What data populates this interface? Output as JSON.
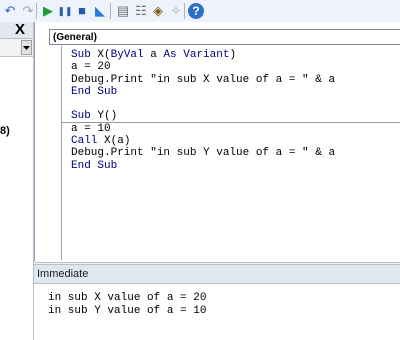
{
  "toolbar": {
    "buttons": [
      {
        "name": "undo-icon",
        "glyph": "↶",
        "color": "#2f67b6"
      },
      {
        "name": "redo-icon",
        "glyph": "↷",
        "color": "#9aa5b5"
      },
      {
        "name": "run-icon",
        "glyph": "▶",
        "color": "#1d9b2f"
      },
      {
        "name": "pause-icon",
        "glyph": "❚❚",
        "color": "#1f5fa8"
      },
      {
        "name": "stop-icon",
        "glyph": "■",
        "color": "#1f5fa8"
      },
      {
        "name": "design-mode-icon",
        "glyph": "◣",
        "color": "#2b7bd6"
      },
      {
        "name": "project-explorer-icon",
        "glyph": "▤",
        "color": "#6a6f7a"
      },
      {
        "name": "properties-icon",
        "glyph": "☷",
        "color": "#6a6f7a"
      },
      {
        "name": "object-browser-icon",
        "glyph": "◈",
        "color": "#7a5b12"
      },
      {
        "name": "toolbox-icon",
        "glyph": "✧",
        "color": "#a9adb5"
      },
      {
        "name": "help-icon",
        "glyph": "?",
        "color": "#ffffff"
      }
    ]
  },
  "left_panel": {
    "close_label": "X",
    "partial_text": "8)"
  },
  "code_window": {
    "procedure_dropdown": "(General)",
    "lines": [
      [
        {
          "t": "Sub ",
          "k": true
        },
        {
          "t": "X(",
          "k": false
        },
        {
          "t": "ByVal",
          "k": true
        },
        {
          "t": " a ",
          "k": false
        },
        {
          "t": "As Variant",
          "k": true
        },
        {
          "t": ")",
          "k": false
        }
      ],
      [
        {
          "t": "a = 20",
          "k": false
        }
      ],
      [
        {
          "t": "Debug.Print \"in sub X value of a = \" & a",
          "k": false
        }
      ],
      [
        {
          "t": "End Sub",
          "k": true
        }
      ],
      [],
      [
        {
          "t": "Sub ",
          "k": true
        },
        {
          "t": "Y()",
          "k": false
        }
      ],
      [
        {
          "t": "a = 10",
          "k": false
        }
      ],
      [
        {
          "t": "Call ",
          "k": true
        },
        {
          "t": "X(a)",
          "k": false
        }
      ],
      [
        {
          "t": "Debug.Print \"in sub Y value of a = \" & a",
          "k": false
        }
      ],
      [
        {
          "t": "End Sub",
          "k": true
        }
      ]
    ]
  },
  "immediate": {
    "title": "Immediate",
    "output": [
      "in sub X value of a = 20",
      "in sub Y value of a = 10"
    ]
  },
  "colors": {
    "keyword": "#00007f",
    "toolbar_bg": "#eef3fb",
    "immediate_title_bg": "#dfe7f1"
  }
}
